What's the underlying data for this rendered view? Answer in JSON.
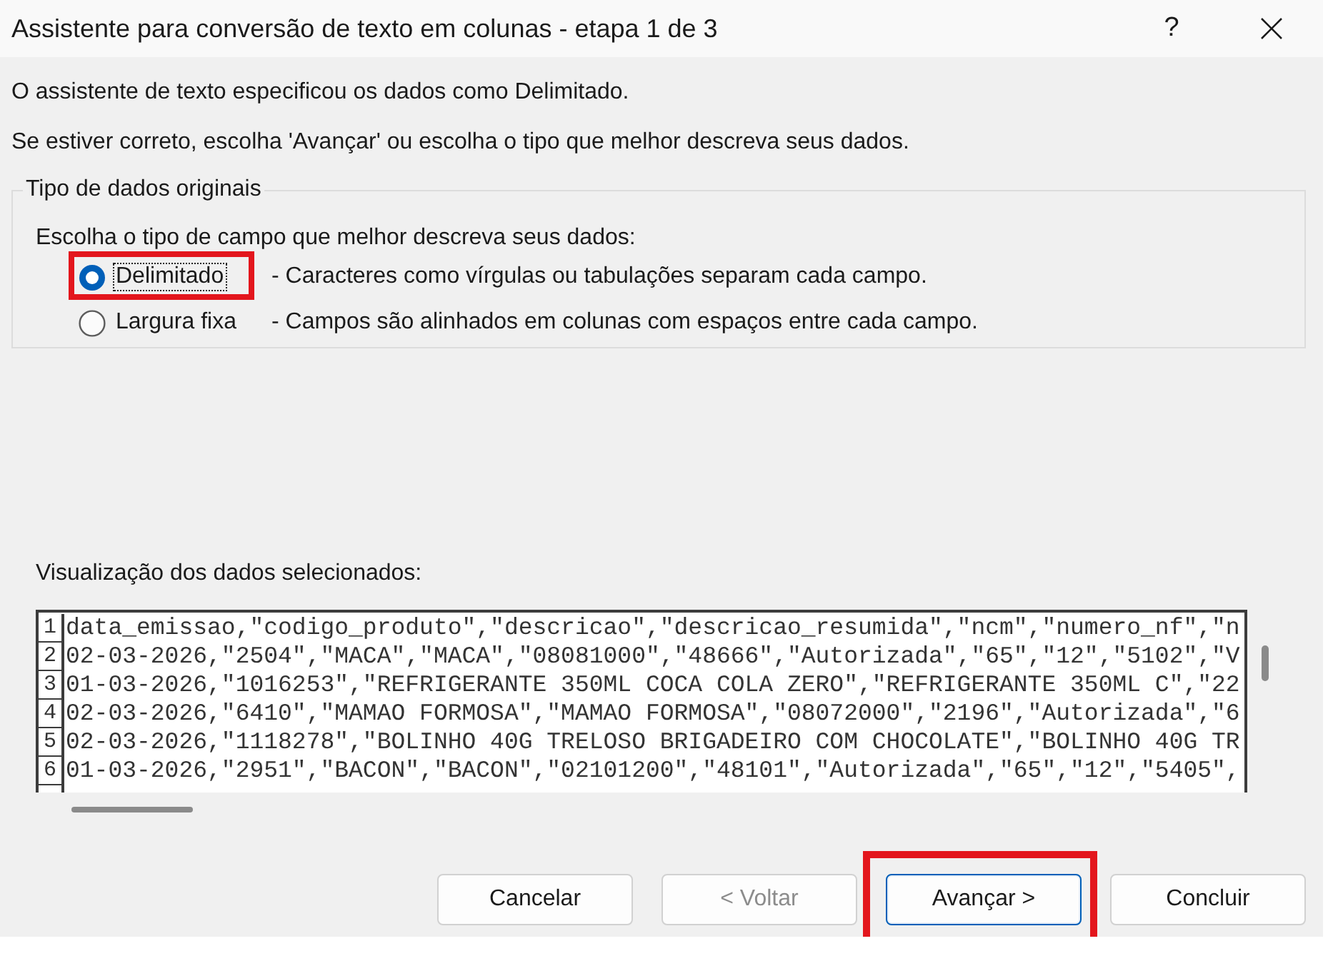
{
  "window": {
    "title": "Assistente para conversão de texto em colunas - etapa 1 de 3",
    "help_label": "?"
  },
  "intro": [
    "O assistente de texto especificou os dados como Delimitado.",
    "Se estiver correto, escolha 'Avançar' ou escolha o tipo que melhor descreva seus dados."
  ],
  "group": {
    "legend": "Tipo de dados originais",
    "prompt": "Escolha o tipo de campo que melhor descreva seus dados:",
    "options": [
      {
        "label": "Delimitado",
        "description": "- Caracteres como vírgulas ou tabulações separam cada campo.",
        "selected": true,
        "focused": true,
        "highlighted": true
      },
      {
        "label": "Largura fixa",
        "description": "- Campos são alinhados em colunas com espaços entre cada campo.",
        "selected": false,
        "focused": false,
        "highlighted": false
      }
    ]
  },
  "preview": {
    "label": "Visualização dos dados selecionados:",
    "rows": [
      {
        "number": "1",
        "text": "data_emissao,\"codigo_produto\",\"descricao\",\"descricao_resumida\",\"ncm\",\"numero_nf\",\"n"
      },
      {
        "number": "2",
        "text": "02-03-2026,\"2504\",\"MACA\",\"MACA\",\"08081000\",\"48666\",\"Autorizada\",\"65\",\"12\",\"5102\",\"V"
      },
      {
        "number": "3",
        "text": "01-03-2026,\"1016253\",\"REFRIGERANTE 350ML COCA COLA ZERO\",\"REFRIGERANTE 350ML C\",\"22"
      },
      {
        "number": "4",
        "text": "02-03-2026,\"6410\",\"MAMAO FORMOSA\",\"MAMAO FORMOSA\",\"08072000\",\"2196\",\"Autorizada\",\"6"
      },
      {
        "number": "5",
        "text": "02-03-2026,\"1118278\",\"BOLINHO 40G TRELOSO BRIGADEIRO COM CHOCOLATE\",\"BOLINHO 40G TR"
      },
      {
        "number": "6",
        "text": "01-03-2026,\"2951\",\"BACON\",\"BACON\",\"02101200\",\"48101\",\"Autorizada\",\"65\",\"12\",\"5405\","
      }
    ]
  },
  "buttons": [
    {
      "label": "Cancelar",
      "disabled": false,
      "default": false,
      "highlighted": false
    },
    {
      "label": "< Voltar",
      "disabled": true,
      "default": false,
      "highlighted": false
    },
    {
      "label": "Avançar >",
      "disabled": false,
      "default": true,
      "highlighted": true
    },
    {
      "label": "Concluir",
      "disabled": false,
      "default": false,
      "highlighted": false
    }
  ]
}
